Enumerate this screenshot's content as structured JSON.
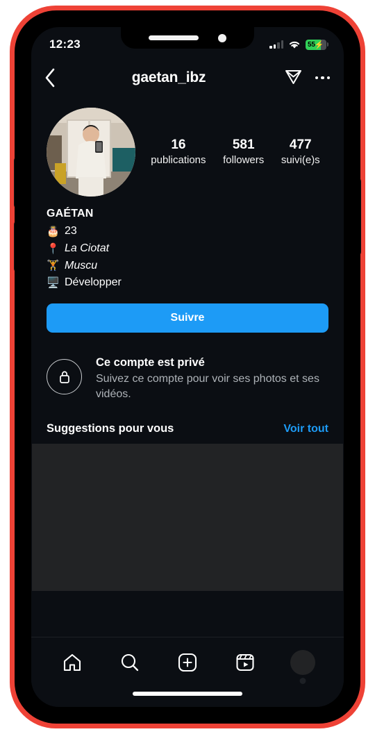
{
  "status_bar": {
    "time": "12:23",
    "battery_percent": "55",
    "battery_charging_icon": "bolt-icon",
    "wifi_icon": "wifi-icon",
    "signal_icon": "cellular-signal-icon"
  },
  "header": {
    "back_icon": "chevron-left-icon",
    "username": "gaetan_ibz",
    "share_icon": "paper-plane-icon",
    "more_icon": "ellipsis-horizontal-icon"
  },
  "profile": {
    "avatar_name": "profile-photo",
    "stats": [
      {
        "value": "16",
        "label": "publications"
      },
      {
        "value": "581",
        "label": "followers"
      },
      {
        "value": "477",
        "label": "suivi(e)s"
      }
    ],
    "display_name": "GAÉTAN",
    "bio_lines": [
      {
        "emoji": "🎂",
        "emoji_name": "birthday-cake-emoji",
        "text": "23",
        "italic": false
      },
      {
        "emoji": "📍",
        "emoji_name": "pushpin-emoji",
        "text": "La Ciotat",
        "italic": true
      },
      {
        "emoji": "🏋️",
        "emoji_name": "weightlifter-emoji",
        "text": "Muscu",
        "italic": true
      },
      {
        "emoji": "🖥️",
        "emoji_name": "desktop-computer-emoji",
        "text": "Développer",
        "italic": false
      }
    ],
    "follow_button": "Suivre"
  },
  "private_notice": {
    "lock_icon": "lock-icon",
    "title": "Ce compte est privé",
    "subtitle": "Suivez ce compte pour voir ses photos et ses vidéos."
  },
  "suggestions": {
    "title": "Suggestions pour vous",
    "see_all": "Voir tout"
  },
  "tab_bar": {
    "items": [
      {
        "icon": "home-icon"
      },
      {
        "icon": "search-icon"
      },
      {
        "icon": "add-post-icon"
      },
      {
        "icon": "reels-icon"
      },
      {
        "icon": "profile-avatar-icon"
      }
    ]
  },
  "colors": {
    "accent_blue": "#1d9bf6",
    "frame_red": "#ee4236",
    "battery_green": "#31d158",
    "screen_background": "#0b0e13",
    "placeholder_gray": "#222325"
  }
}
